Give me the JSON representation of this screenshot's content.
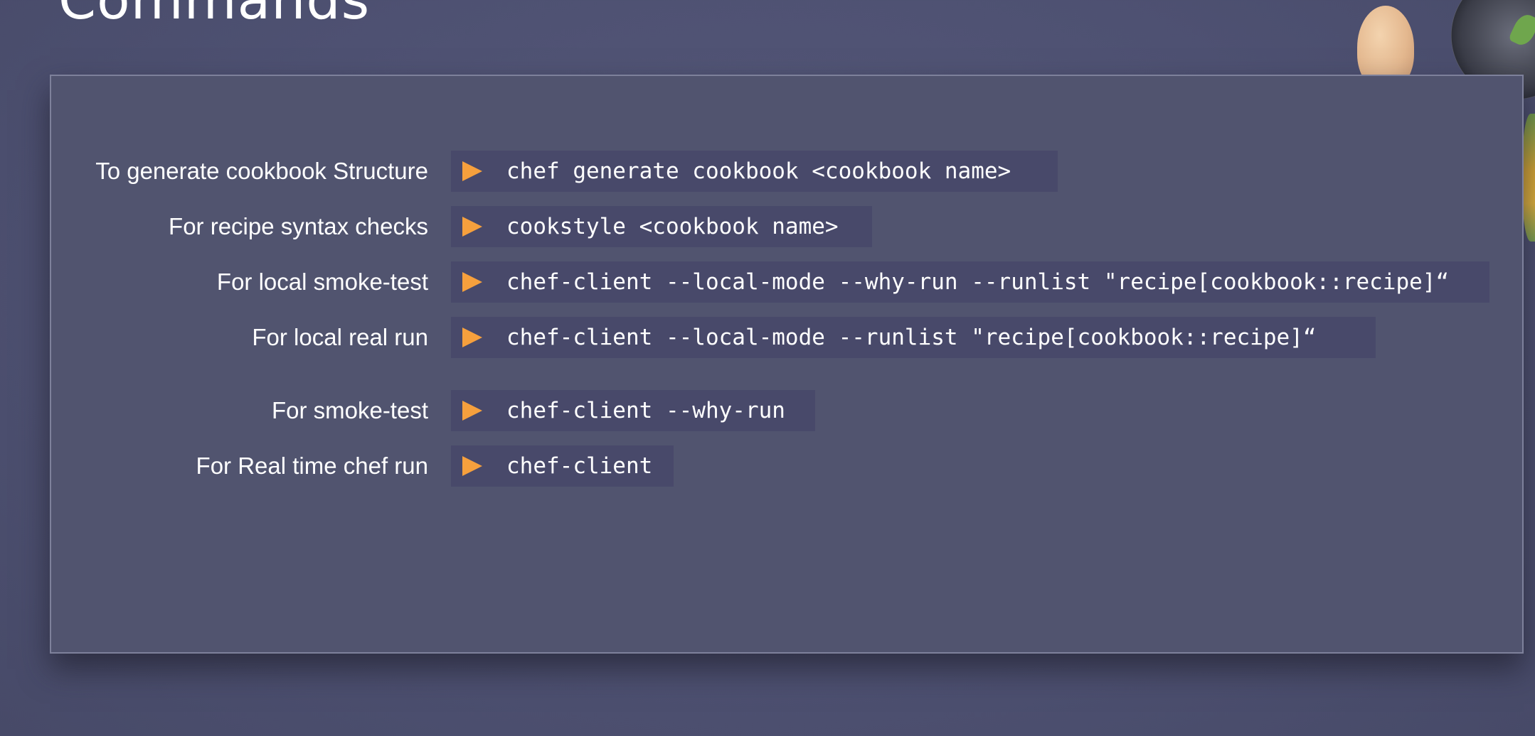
{
  "slide": {
    "title": "Commands"
  },
  "commands": [
    {
      "label": "To generate cookbook Structure",
      "command": "chef generate cookbook <cookbook name>",
      "icon": "orange-triangle-icon"
    },
    {
      "label": "For recipe syntax checks",
      "command": "cookstyle <cookbook name>",
      "icon": "orange-triangle-icon"
    },
    {
      "label": "For local smoke-test",
      "command": "chef-client --local-mode --why-run --runlist \"recipe[cookbook::recipe]“",
      "icon": "orange-triangle-icon"
    },
    {
      "label": "For local real run",
      "command": "chef-client --local-mode --runlist \"recipe[cookbook::recipe]“",
      "icon": "orange-triangle-icon"
    },
    {
      "label": "For smoke-test",
      "command": "chef-client --why-run",
      "icon": "orange-triangle-icon"
    },
    {
      "label": "For Real time chef run",
      "command": "chef-client",
      "icon": "orange-triangle-icon"
    }
  ],
  "colors": {
    "background": "#4e5172",
    "panel": "#51546f",
    "command_box": "#48496a",
    "bullet_accent": "#f6a03d",
    "text": "#ffffff"
  }
}
